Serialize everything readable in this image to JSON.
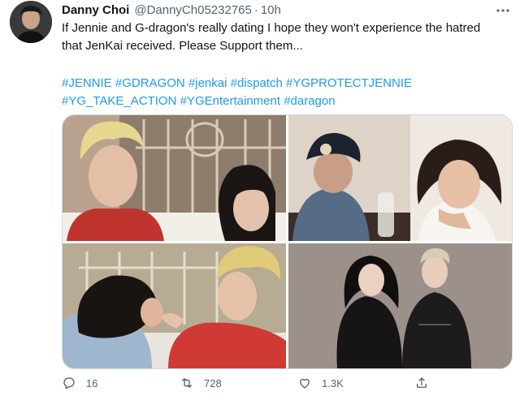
{
  "tweet": {
    "display_name": "Danny Choi",
    "handle": "@DannyCh05232765",
    "separator": "·",
    "time": "10h",
    "text": "If Jennie and G-dragon's really dating I hope they won't experience the hatred that JenKai received. Please Support them...",
    "hashtags": [
      "#JENNIE",
      "#GDRAGON",
      "#jenkai",
      "#dispatch",
      "#YGPROTECTJENNIE",
      "#YG_TAKE_ACTION",
      "#YGEntertainment",
      "#daragon"
    ]
  },
  "actions": {
    "reply_count": "16",
    "retweet_count": "728",
    "like_count": "1.3K"
  },
  "icons": {
    "more": "more-dots-icon",
    "reply": "reply-icon",
    "retweet": "retweet-icon",
    "like": "heart-icon",
    "share": "share-icon"
  },
  "colors": {
    "link": "#1d9bf0",
    "secondary_text": "#536471",
    "primary_text": "#0f1419",
    "border": "#cfd9de"
  }
}
